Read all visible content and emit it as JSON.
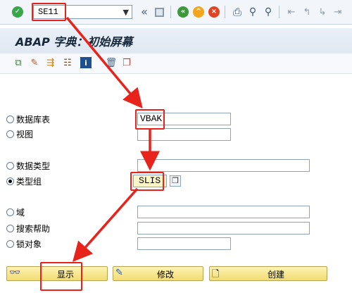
{
  "toolbar": {
    "transaction_code": "SE11",
    "dropdown_icon": "chevron-down-icon",
    "icons": [
      "enter-icon",
      "back-icon",
      "exit-icon",
      "cancel-icon",
      "print-icon",
      "find-icon",
      "first-page-icon",
      "prev-page-icon",
      "next-page-icon",
      "last-page-icon"
    ]
  },
  "title": "ABAP 字典：初始屏幕",
  "options": {
    "database_table": {
      "label": "数据库表",
      "value": "VBAK",
      "selected": false
    },
    "view": {
      "label": "视图",
      "value": "",
      "selected": false
    },
    "data_type": {
      "label": "数据类型",
      "value": "",
      "selected": false
    },
    "type_group": {
      "label": "类型组",
      "value": "SLIS",
      "selected": true
    },
    "domain": {
      "label": "域",
      "value": "",
      "selected": false
    },
    "search_help": {
      "label": "搜索帮助",
      "value": "",
      "selected": false
    },
    "lock_object": {
      "label": "锁对象",
      "value": "",
      "selected": false
    }
  },
  "buttons": {
    "display": "显示",
    "change": "修改",
    "create": "创建"
  },
  "annotation_color": "#e8231c"
}
